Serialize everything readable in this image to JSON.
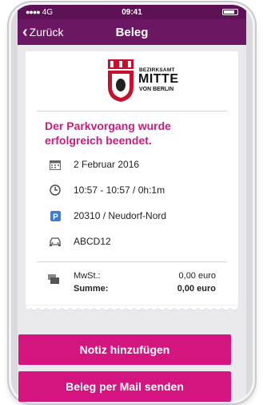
{
  "status_bar": {
    "carrier": "4G",
    "time": "09:41"
  },
  "nav": {
    "back_label": "Zurück",
    "title": "Beleg"
  },
  "logo": {
    "line1": "BEZIRKSAMT",
    "line2": "MITTE",
    "line3": "VON BERLIN"
  },
  "message": "Der Parkvorgang wurde erfolgreich beendet.",
  "details": [
    {
      "icon": "calendar-icon",
      "text": "2 Februar 2016"
    },
    {
      "icon": "clock-icon",
      "text": "10:57 - 10:57 / 0h:1m"
    },
    {
      "icon": "parking-icon",
      "text": "20310 / Neudorf-Nord"
    },
    {
      "icon": "car-icon",
      "text": "ABCD12"
    }
  ],
  "totals": {
    "tax_label": "MwSt.:",
    "tax_value": "0,00 euro",
    "sum_label": "Summe:",
    "sum_value": "0,00 euro"
  },
  "actions": {
    "add_note": "Notiz hinzufügen",
    "send_mail": "Beleg per Mail senden"
  },
  "colors": {
    "nav": "#6b1763",
    "accent": "#cc1a80",
    "button": "#d4157f"
  }
}
